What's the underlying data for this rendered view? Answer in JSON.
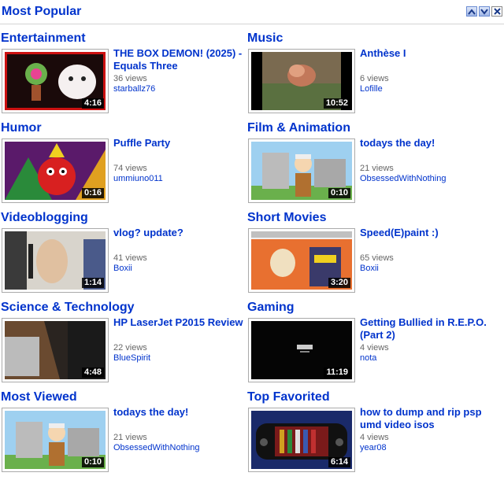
{
  "header": {
    "title": "Most Popular"
  },
  "categories": [
    {
      "name": "Entertainment",
      "video": {
        "title": "THE BOX DEMON! (2025) - Equals Three",
        "views": "36 views",
        "user": "starballz76",
        "duration": "4:16"
      }
    },
    {
      "name": "Music",
      "video": {
        "title": "Anthèse I",
        "views": "6 views",
        "user": "Lofille",
        "duration": "10:52"
      }
    },
    {
      "name": "Humor",
      "video": {
        "title": "Puffle Party",
        "views": "74 views",
        "user": "ummiuno011",
        "duration": "0:16"
      }
    },
    {
      "name": "Film & Animation",
      "video": {
        "title": "todays the day!",
        "views": "21 views",
        "user": "ObsessedWithNothing",
        "duration": "0:10"
      }
    },
    {
      "name": "Videoblogging",
      "video": {
        "title": "vlog? update?",
        "views": "41 views",
        "user": "Boxii",
        "duration": "1:14"
      }
    },
    {
      "name": "Short Movies",
      "video": {
        "title": "Speed(E)paint :)",
        "views": "65 views",
        "user": "Boxii",
        "duration": "3:20"
      }
    },
    {
      "name": "Science & Technology",
      "video": {
        "title": "HP LaserJet P2015 Review",
        "views": "22 views",
        "user": "BlueSpirit",
        "duration": "4:48"
      }
    },
    {
      "name": "Gaming",
      "video": {
        "title": "Getting Bullied in R.E.P.O. (Part 2)",
        "views": "4 views",
        "user": "nota",
        "duration": "11:19"
      }
    },
    {
      "name": "Most Viewed",
      "video": {
        "title": "todays the day!",
        "views": "21 views",
        "user": "ObsessedWithNothing",
        "duration": "0:10"
      }
    },
    {
      "name": "Top Favorited",
      "video": {
        "title": "how to dump and rip psp umd video isos",
        "views": "4 views",
        "user": "year08",
        "duration": "6:14"
      }
    }
  ]
}
